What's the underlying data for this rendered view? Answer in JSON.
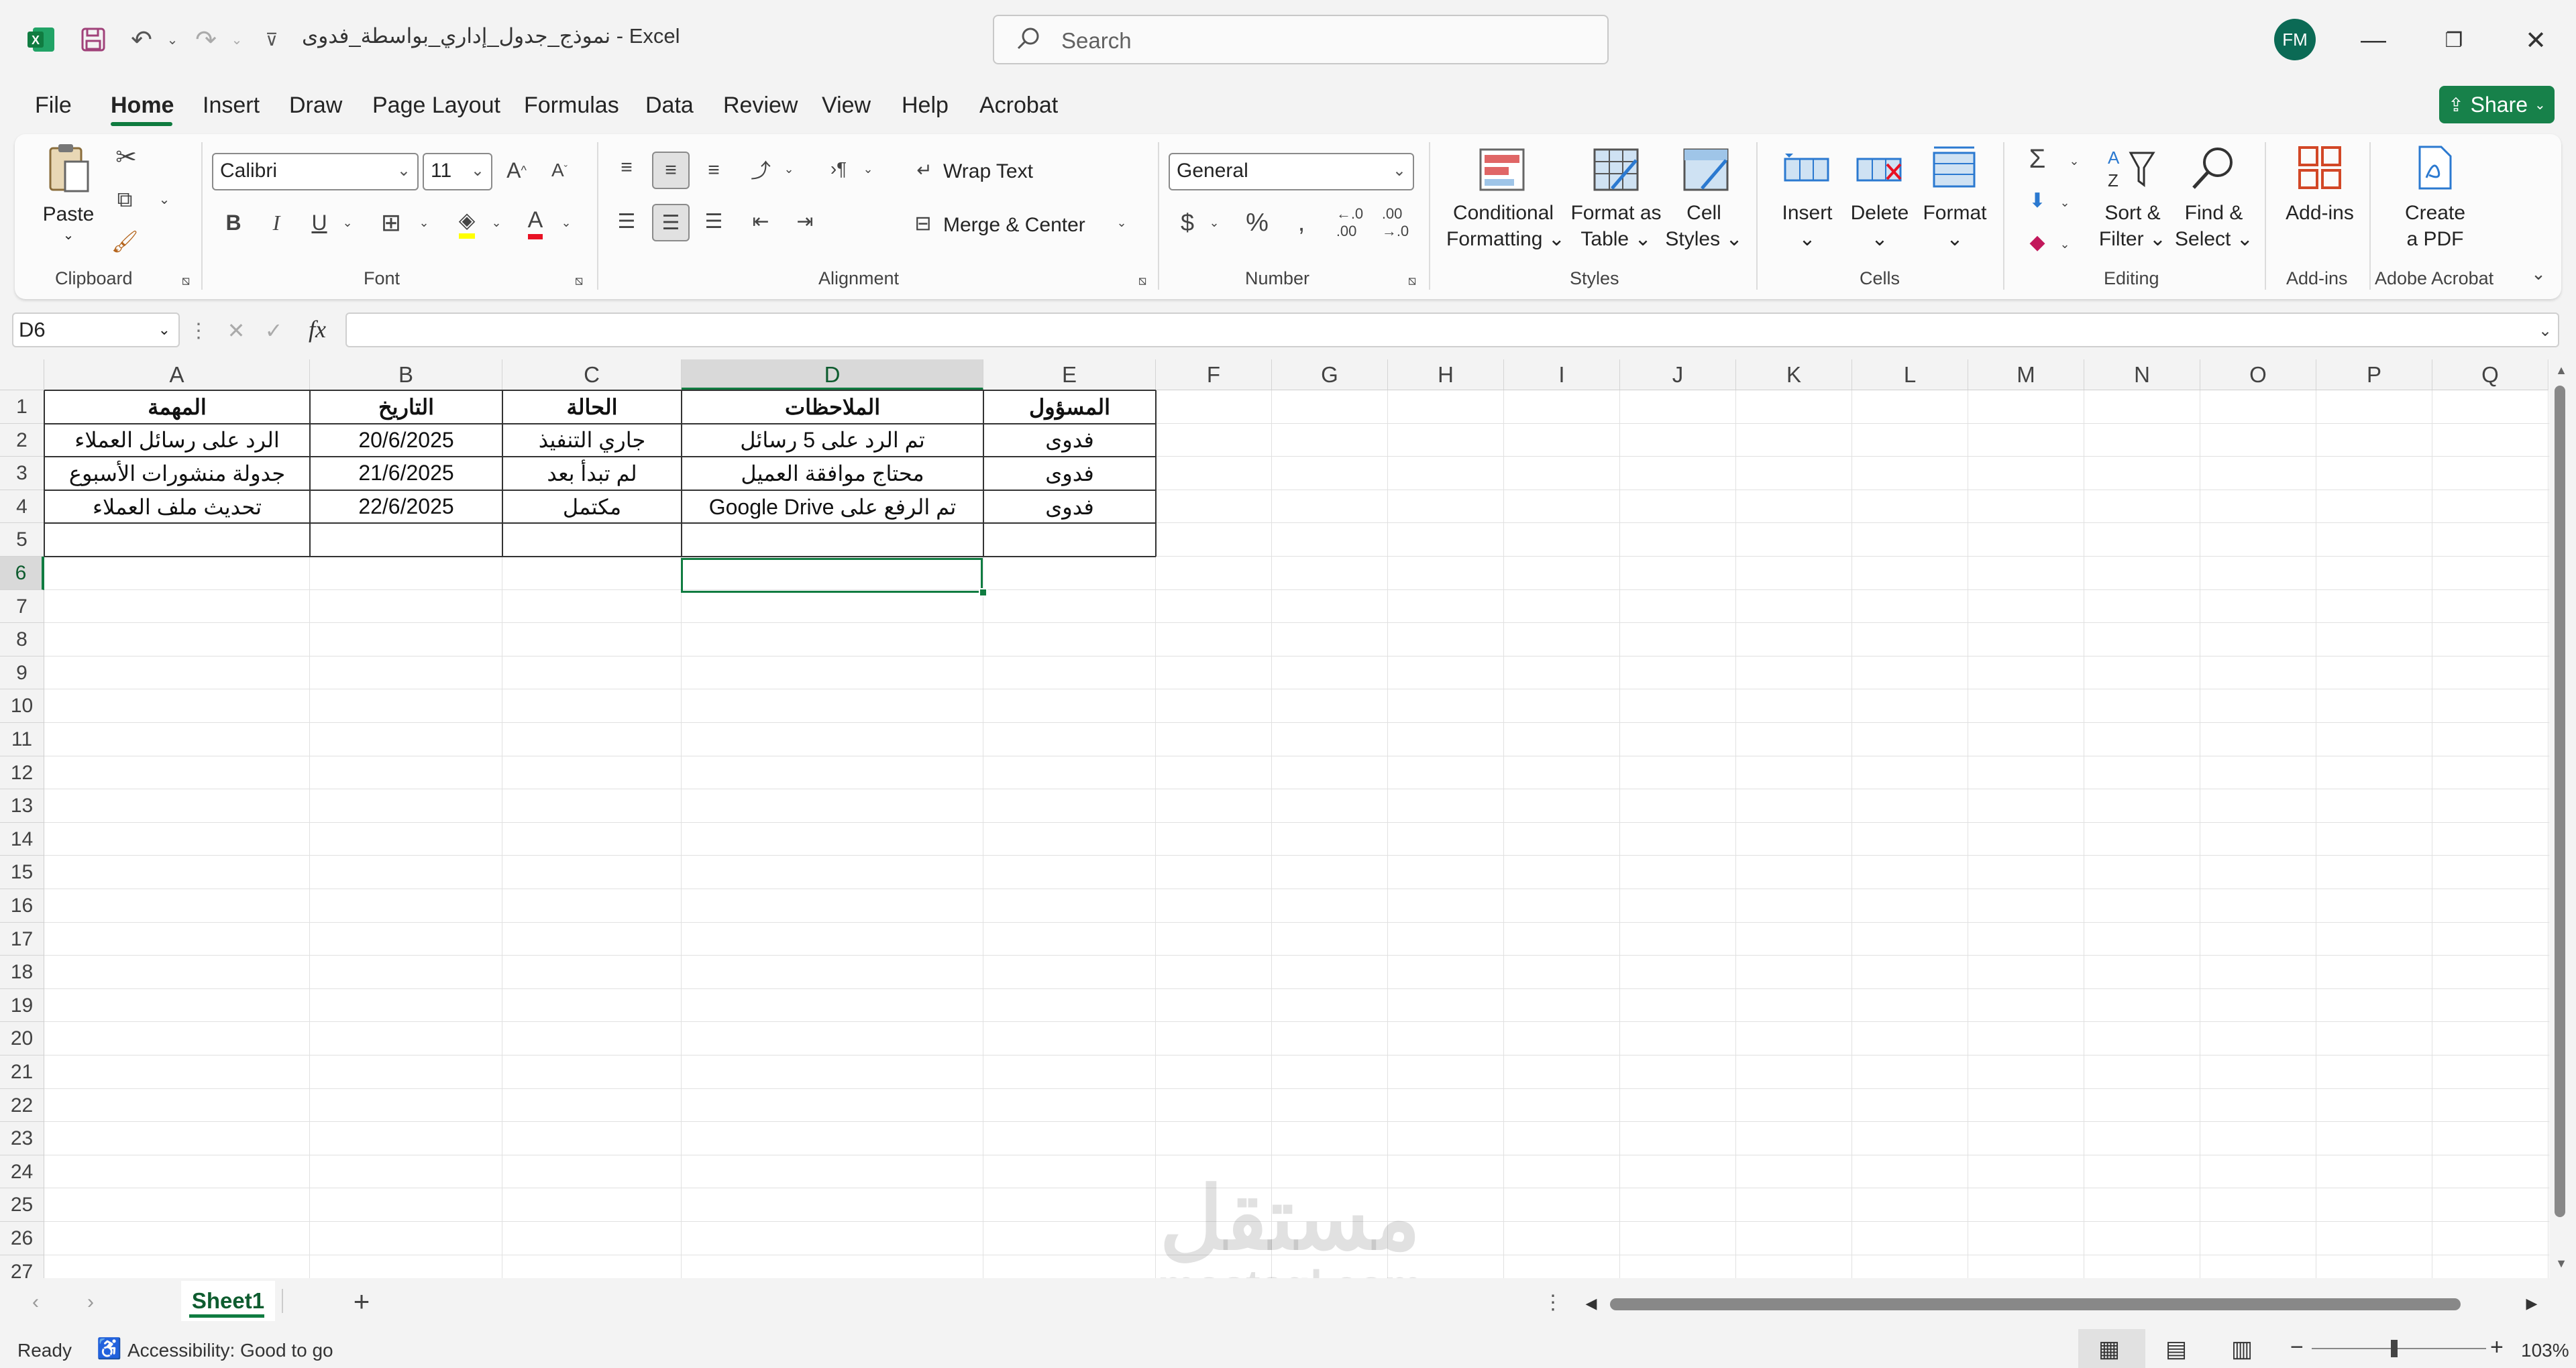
{
  "titlebar": {
    "doc_title": "نموذج_جدول_إداري_بواسطة_فدوى  -  Excel",
    "search_placeholder": "Search",
    "avatar_initials": "FM"
  },
  "menu": {
    "tabs": [
      "File",
      "Home",
      "Insert",
      "Draw",
      "Page Layout",
      "Formulas",
      "Data",
      "Review",
      "View",
      "Help",
      "Acrobat"
    ],
    "active": "Home",
    "share_label": "Share"
  },
  "ribbon": {
    "clipboard": {
      "paste": "Paste",
      "label": "Clipboard"
    },
    "font": {
      "name": "Calibri",
      "size": "11",
      "label": "Font",
      "bold": "B",
      "italic": "I",
      "underline": "U"
    },
    "alignment": {
      "wrap": "Wrap Text",
      "merge": "Merge & Center",
      "label": "Alignment"
    },
    "number": {
      "format": "General",
      "label": "Number"
    },
    "styles": {
      "cond1": "Conditional",
      "cond2": "Formatting",
      "fmt1": "Format as",
      "fmt2": "Table",
      "cell1": "Cell",
      "cell2": "Styles",
      "label": "Styles"
    },
    "cells": {
      "insert": "Insert",
      "delete": "Delete",
      "format": "Format",
      "label": "Cells"
    },
    "editing": {
      "sort1": "Sort &",
      "sort2": "Filter",
      "find1": "Find &",
      "find2": "Select",
      "label": "Editing"
    },
    "addins": {
      "btn": "Add-ins",
      "label": "Add-ins"
    },
    "acrobat": {
      "btn1": "Create",
      "btn2": "a PDF",
      "label": "Adobe Acrobat"
    }
  },
  "formula_bar": {
    "name_box": "D6",
    "fx": "fx",
    "content": ""
  },
  "grid": {
    "columns": [
      "A",
      "B",
      "C",
      "D",
      "E",
      "F",
      "G",
      "H",
      "I",
      "J",
      "K",
      "L",
      "M",
      "N",
      "O",
      "P",
      "Q"
    ],
    "selected_column": "D",
    "selected_row": "6",
    "rows": [
      "1",
      "2",
      "3",
      "4",
      "5",
      "6",
      "7",
      "8",
      "9",
      "10",
      "11",
      "12",
      "13",
      "14",
      "15",
      "16",
      "17",
      "18",
      "19",
      "20",
      "21",
      "22",
      "23",
      "24",
      "25",
      "26",
      "27"
    ],
    "table": [
      [
        "المهمة",
        "التاريخ",
        "الحالة",
        "الملاحظات",
        "المسؤول"
      ],
      [
        "الرد على رسائل العملاء",
        "20/6/2025",
        "جاري التنفيذ",
        "تم الرد على 5 رسائل",
        "فدوى"
      ],
      [
        "جدولة منشورات الأسبوع",
        "21/6/2025",
        "لم تبدأ بعد",
        "محتاج موافقة العميل",
        "فدوى"
      ],
      [
        "تحديث ملف العملاء",
        "22/6/2025",
        "مكتمل",
        "تم الرفع على Google Drive",
        "فدوى"
      ],
      [
        "",
        "",
        "",
        "",
        ""
      ]
    ]
  },
  "sheets": {
    "active": "Sheet1",
    "add": "+"
  },
  "status": {
    "ready": "Ready",
    "accessibility": "Accessibility: Good to go",
    "zoom": "103%"
  },
  "watermark": {
    "arabic": "مستقل",
    "latin": "mostaql.com"
  }
}
